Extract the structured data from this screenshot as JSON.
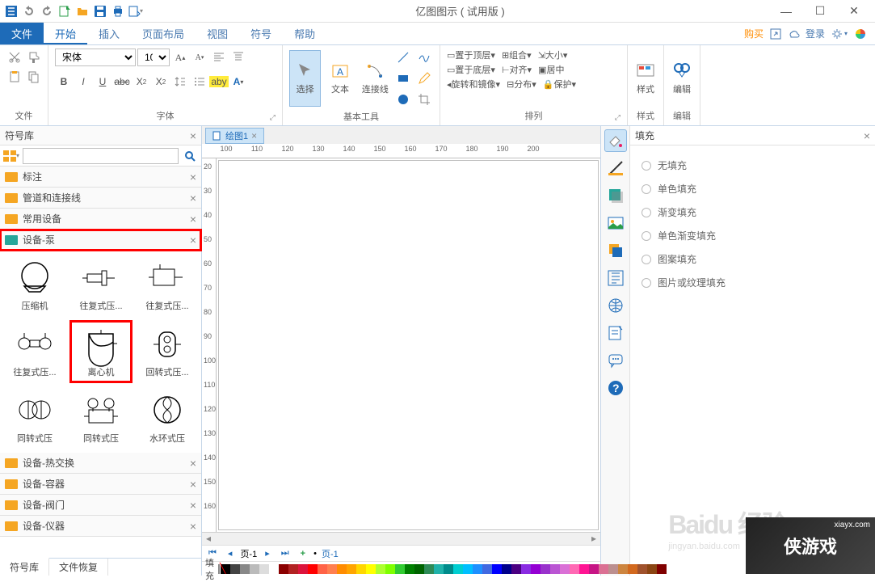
{
  "app": {
    "title": "亿图图示 ( 试用版 )"
  },
  "qat": [
    "new-icon",
    "undo-icon",
    "redo-icon",
    "file-icon",
    "save-icon",
    "open-icon",
    "print-icon",
    "export-icon"
  ],
  "win": [
    "minimize",
    "maximize",
    "close"
  ],
  "menu": {
    "tabs": [
      "文件",
      "开始",
      "插入",
      "页面布局",
      "视图",
      "符号",
      "帮助"
    ],
    "activeIndex": 1,
    "right": {
      "buy": "购买",
      "login": "登录"
    }
  },
  "ribbon": {
    "groups": {
      "file": {
        "label": "文件"
      },
      "font": {
        "label": "字体",
        "name": "宋体",
        "size": "10"
      },
      "basicTools": {
        "label": "基本工具",
        "select": "选择",
        "text": "文本",
        "connector": "连接线"
      },
      "arrange": {
        "label": "排列",
        "items": {
          "bringFront": "置于顶层",
          "sendBack": "置于底层",
          "rotateMirror": "旋转和镜像",
          "group": "组合",
          "align": "对齐",
          "distribute": "分布",
          "size": "大小",
          "center": "居中",
          "protect": "保护"
        }
      },
      "style": {
        "label": "样式"
      },
      "edit": {
        "label": "编辑"
      }
    }
  },
  "symbolLib": {
    "header": "符号库",
    "searchPlaceholder": "",
    "categories": [
      {
        "label": "标注",
        "highlighted": false
      },
      {
        "label": "管道和连接线",
        "highlighted": false
      },
      {
        "label": "常用设备",
        "highlighted": false
      },
      {
        "label": "设备-泵",
        "highlighted": true
      },
      {
        "label": "设备-热交换",
        "highlighted": false
      },
      {
        "label": "设备-容器",
        "highlighted": false
      },
      {
        "label": "设备-阀门",
        "highlighted": false
      },
      {
        "label": "设备-仪器",
        "highlighted": false
      }
    ],
    "symbols": [
      {
        "label": "压缩机",
        "shape": "compressor"
      },
      {
        "label": "往复式压...",
        "shape": "recip1"
      },
      {
        "label": "往复式压...",
        "shape": "recip2"
      },
      {
        "label": "往复式压...",
        "shape": "recip3"
      },
      {
        "label": "离心机",
        "shape": "centrifuge",
        "highlighted": true
      },
      {
        "label": "回转式压...",
        "shape": "rotary1"
      },
      {
        "label": "同转式压",
        "shape": "rotary2"
      },
      {
        "label": "同转式压",
        "shape": "rotary3"
      },
      {
        "label": "水环式压",
        "shape": "waterring"
      }
    ],
    "tabs": [
      "符号库",
      "文件恢复"
    ]
  },
  "document": {
    "tab": "绘图1",
    "rulerH": [
      100,
      110,
      120,
      130,
      140,
      150,
      160,
      170,
      180,
      190,
      200
    ],
    "rulerV": [
      20,
      30,
      40,
      50,
      60,
      70,
      80,
      90,
      100,
      110,
      120,
      130,
      140,
      150,
      160
    ]
  },
  "pageNav": {
    "sheet": "页-1",
    "page": "页-1"
  },
  "colorBar": {
    "label": "填充"
  },
  "rightPanel": {
    "header": "填充",
    "options": [
      "无填充",
      "单色填充",
      "渐变填充",
      "单色渐变填充",
      "图案填充",
      "图片或纹理填充"
    ]
  },
  "watermark": {
    "baidu": "Baidu 经验",
    "baiduSub": "jingyan.baidu.com",
    "game": "侠游戏",
    "gameSub": "xiayx.com"
  },
  "colors": {
    "accent": "#1e6bb8",
    "highlight": "#ff0000"
  }
}
